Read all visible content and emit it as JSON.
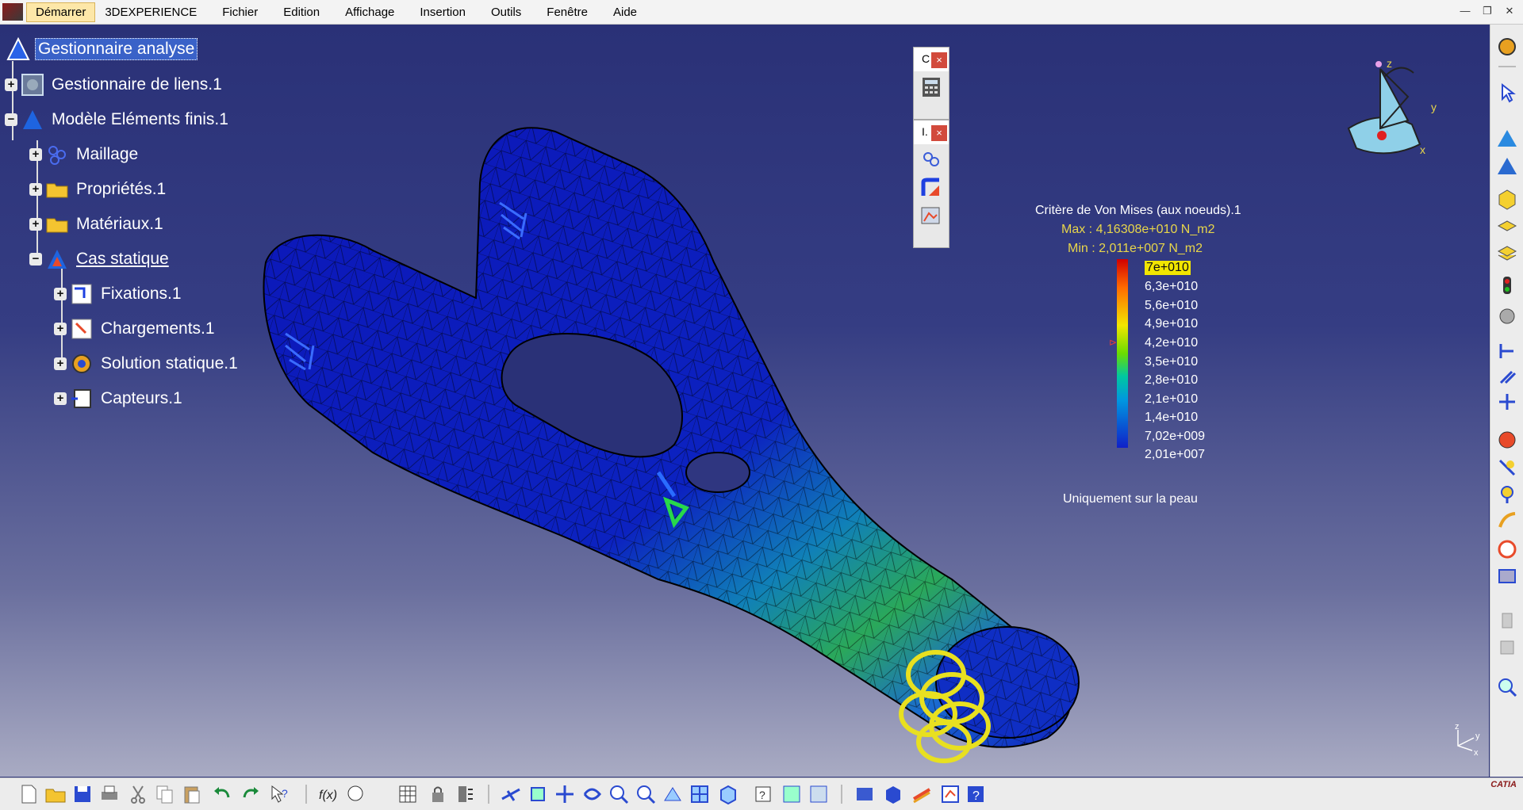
{
  "menu": {
    "items": [
      "Démarrer",
      "3DEXPERIENCE",
      "Fichier",
      "Edition",
      "Affichage",
      "Insertion",
      "Outils",
      "Fenêtre",
      "Aide"
    ]
  },
  "window_buttons": [
    "—",
    "❐",
    "✕"
  ],
  "tree": {
    "nodes": [
      {
        "label": "Gestionnaire analyse",
        "icon": "analysis-manager-icon",
        "selected": true
      },
      {
        "label": "Gestionnaire de liens.1",
        "icon": "links-manager-icon"
      },
      {
        "label": "Modèle Eléments finis.1",
        "icon": "finite-element-model-icon"
      },
      {
        "label": "Maillage",
        "icon": "mesh-icon"
      },
      {
        "label": "Propriétés.1",
        "icon": "folder-icon"
      },
      {
        "label": "Matériaux.1",
        "icon": "folder-icon"
      },
      {
        "label": "Cas statique",
        "icon": "static-case-icon",
        "underlined": true
      },
      {
        "label": "Fixations.1",
        "icon": "restraints-icon"
      },
      {
        "label": "Chargements.1",
        "icon": "loads-icon"
      },
      {
        "label": "Solution statique.1",
        "icon": "static-solution-icon"
      },
      {
        "label": "Capteurs.1",
        "icon": "sensors-icon"
      }
    ]
  },
  "floating_toolbars": {
    "tb1_title": "C",
    "tb2_title": "I.",
    "close": "×"
  },
  "legend": {
    "title": "Critère de Von Mises (aux noeuds).1",
    "max": "Max : 4,16308e+010 N_m2",
    "min": "Min : 2,011e+007 N_m2",
    "ticks": [
      "7e+010",
      "6,3e+010",
      "5,6e+010",
      "4,9e+010",
      "4,2e+010",
      "3,5e+010",
      "2,8e+010",
      "2,1e+010",
      "1,4e+010",
      "7,02e+009",
      "2,01e+007"
    ],
    "footer": "Uniquement sur la peau",
    "colors": {
      "high": "#d10000",
      "mid": "#f2e600",
      "low": "#1020c8"
    }
  },
  "compass": {
    "x": "x",
    "y": "y",
    "z": "z"
  },
  "mini_axes": {
    "x": "x",
    "y": "y",
    "z": "z"
  },
  "brand": "CATIA"
}
